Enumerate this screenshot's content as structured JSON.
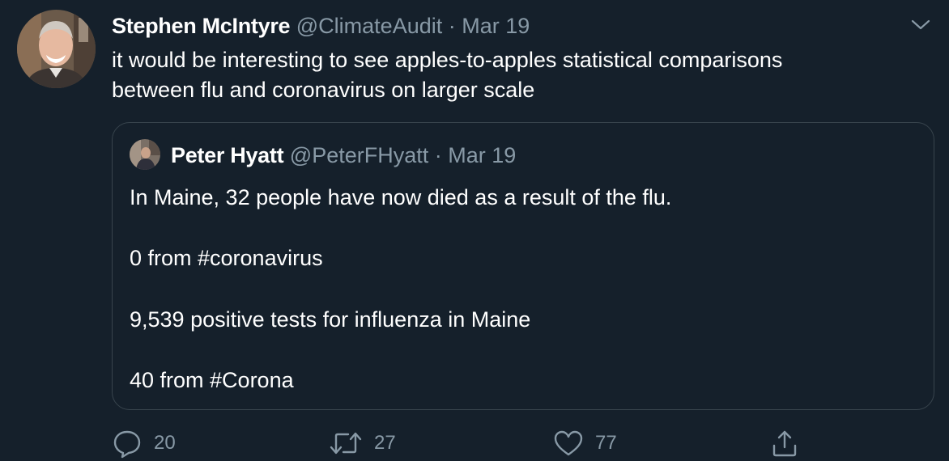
{
  "tweet": {
    "author_name": "Stephen McIntyre",
    "author_handle": "@ClimateAudit",
    "separator": "·",
    "date": "Mar 19",
    "text_line1": "it would be interesting to see apples-to-apples statistical comparisons",
    "text_line2": "between flu and coronavirus on larger scale"
  },
  "quote": {
    "author_name": "Peter Hyatt",
    "author_handle": "@PeterFHyatt",
    "separator": "·",
    "date": "Mar 19",
    "lines": [
      "In Maine, 32 people have now died as a result of the flu.",
      "0 from #coronavirus",
      "9,539 positive tests for influenza in Maine",
      "40 from #Corona"
    ]
  },
  "actions": {
    "reply_count": "20",
    "retweet_count": "27",
    "like_count": "77"
  },
  "icons": [
    "chevron-down-icon",
    "reply-icon",
    "retweet-icon",
    "like-icon",
    "share-icon"
  ],
  "colors": {
    "background": "#15202b",
    "secondary_text": "#8899a6",
    "border": "#38444d"
  }
}
